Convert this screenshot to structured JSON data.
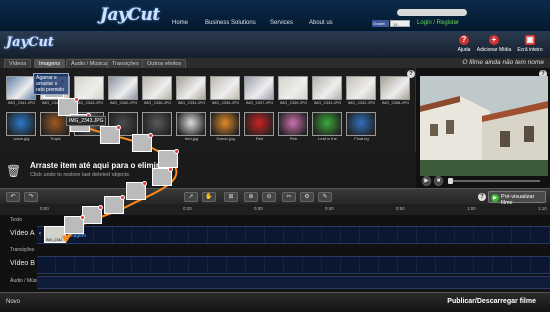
{
  "site": {
    "logo": "JayCut",
    "nav": [
      "Home",
      "Business Solutions",
      "Services",
      "About us"
    ],
    "facebook_label": "Gostei",
    "facebook_count": "13",
    "login": "Login / Register"
  },
  "app": {
    "logo": "JayCut",
    "header_buttons": [
      {
        "label": "Ajuda",
        "icon": "help-icon"
      },
      {
        "label": "Adicionar Mídia",
        "icon": "add-media-icon"
      },
      {
        "label": "Ecrã inteiro",
        "icon": "fullscreen-icon"
      }
    ],
    "tabs": [
      "Vídeos",
      "Imagens",
      "Áudio / Música",
      "Transições",
      "Outros efeitos"
    ],
    "active_tab": "Imagens",
    "preview_title": "O filme ainda não tem nome"
  },
  "library": {
    "row1": [
      "IMG_2341.JPG",
      "IMG_2342.JPG",
      "IMG_2343.JPG",
      "IMG_2340.JPG",
      "IMG_2336.JPG",
      "IMG_2334.JPG",
      "IMG_2335.JPG",
      "IMG_2337.JPG",
      "IMG_2339.JPG",
      "IMG_2333.JPG",
      "IMG_2332.JPG",
      "IMG_2338.JPG"
    ],
    "row2": [
      "wave.jpg",
      "Tropic",
      "",
      "",
      "",
      "bird.jpg",
      "Scenic.jpg",
      "Red",
      "Pink",
      "Leaf in the",
      "Float.bg"
    ],
    "drag_hint": "Agarrar e arrastar o rato premido",
    "drag_tooltip": "IMG_2343.JPG",
    "colors": [
      "#5b7fa6",
      "#cfc6b4",
      "#d6d2c6",
      "#8a93a2",
      "#b8b3a8",
      "#a9a29a",
      "#c0bab0",
      "#9aa0aa",
      "#d7d2c8",
      "#b5b2ab",
      "#c5c0b6",
      "#a8a296"
    ],
    "colors2": [
      "#2a7acc",
      "#a05a20",
      "#6b6b6b",
      "#4a4a4a",
      "#5a5a5a",
      "#ddd",
      "#e08a2a",
      "#cc2222",
      "#d070b0",
      "#3aaa3a",
      "#3070c0"
    ]
  },
  "trash": {
    "title": "Arraste item até aqui para o eliminar",
    "subtitle": "Click undo to restore last deleted objects"
  },
  "toolbar": {
    "preview_label": "Pré-visualizar filme"
  },
  "timeline": {
    "ticks": [
      "0:00",
      "0:10",
      "0:20",
      "0:30",
      "0:40",
      "0:50",
      "1:00",
      "1:10"
    ],
    "tracks": {
      "texto": "Texto",
      "video_a": "Vídeo A",
      "transicoes": "Transições",
      "video_b": "Vídeo B",
      "audio": "Áudio / Música"
    },
    "clip_label": "IMG_2341",
    "clip_tooltip": "Imagem"
  },
  "bottom": {
    "novo": "Novo",
    "publish": "Publicar/Descarregar filme"
  }
}
